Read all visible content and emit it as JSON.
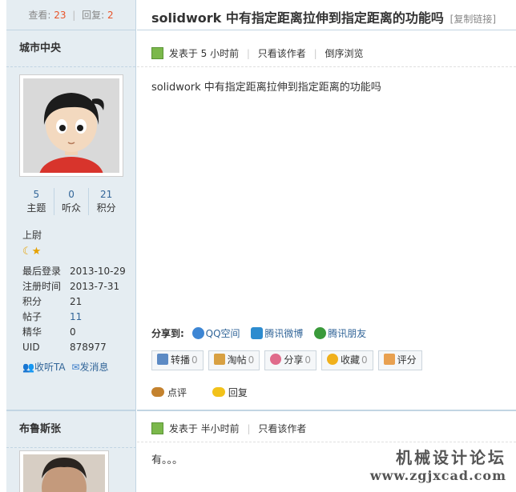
{
  "stats": {
    "views_label": "查看:",
    "views": "23",
    "sep": "|",
    "replies_label": "回复:",
    "replies": "2"
  },
  "thread": {
    "title": "solidwork 中有指定距离拉伸到指定距离的功能吗",
    "copy_link": "[复制链接]"
  },
  "post1": {
    "author": "城市中央",
    "counts": [
      {
        "value": "5",
        "label": "主题"
      },
      {
        "value": "0",
        "label": "听众"
      },
      {
        "value": "21",
        "label": "积分"
      }
    ],
    "rank": "上尉",
    "info": [
      {
        "key": "最后登录",
        "value": "2013-10-29"
      },
      {
        "key": "注册时间",
        "value": "2013-7-31"
      },
      {
        "key": "积分",
        "value": "21"
      },
      {
        "key": "帖子",
        "value": "11"
      },
      {
        "key": "精华",
        "value": "0"
      },
      {
        "key": "UID",
        "value": "878977"
      }
    ],
    "follow": "收听TA",
    "message": "发消息",
    "posted": "发表于 5 小时前",
    "only_author": "只看该作者",
    "reverse": "倒序浏览",
    "content": "solidwork 中有指定距离拉伸到指定距离的功能吗",
    "share_label": "分享到:",
    "share": [
      {
        "name": "QQ空间",
        "color": "#3d86d4"
      },
      {
        "name": "腾讯微博",
        "color": "#2d8ccf"
      },
      {
        "name": "腾讯朋友",
        "color": "#3a9a3a"
      }
    ],
    "buttons": [
      {
        "label": "转播",
        "count": "0",
        "color": "#5c8ac4"
      },
      {
        "label": "淘帖",
        "count": "0",
        "color": "#d8a042"
      },
      {
        "label": "分享",
        "count": "0",
        "color": "#e06b8b"
      },
      {
        "label": "收藏",
        "count": "0",
        "color": "#f0b01c"
      },
      {
        "label": "评分",
        "count": "",
        "color": "#e8a050"
      }
    ],
    "comment": "点评",
    "reply": "回复"
  },
  "post2": {
    "author": "布鲁斯张",
    "posted": "发表于 半小时前",
    "only_author": "只看该作者",
    "content": "有。。。"
  },
  "watermark": {
    "line1": "机械设计论坛",
    "line2": "www.zgjxcad.com"
  }
}
